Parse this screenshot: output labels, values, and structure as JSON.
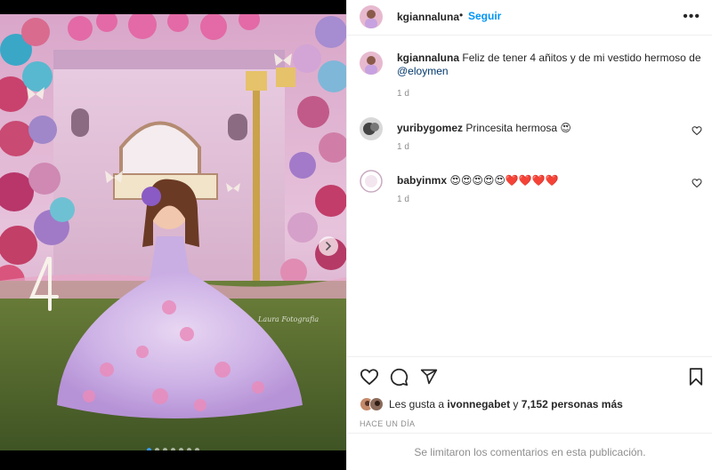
{
  "post": {
    "username": "kgiannaluna",
    "separator": "•",
    "follow_label": "Seguir",
    "more_label": "•••",
    "caption_text": "Feliz de tener 4 añitos y de mi vestido hermoso de ",
    "caption_mention": "@eloymen",
    "caption_time": "1 d",
    "photo_watermark": "Laura Fotografia",
    "carousel_dots": 7,
    "carousel_active": 0
  },
  "comments": [
    {
      "username": "yuribygomez",
      "text": "Princesita hermosa 😍",
      "time": "1 d"
    },
    {
      "username": "babyinmx",
      "text": "😍😍😍😍😍❤️❤️❤️❤️",
      "time": "1 d"
    }
  ],
  "likes": {
    "prefix": "Les gusta a ",
    "user": "ivonnegabet",
    "middle": " y ",
    "count_text": "7,152 personas más"
  },
  "timestamp_label": "HACE UN DÍA",
  "comments_limited": "Se limitaron los comentarios en esta publicación.",
  "colors": {
    "link": "#0095f6",
    "mention": "#00376b",
    "muted": "#8e8e8e",
    "text": "#262626"
  },
  "icons": [
    "more-options-icon",
    "like-icon",
    "comment-icon",
    "share-icon",
    "save-icon",
    "heart-small-icon",
    "next-arrow-icon"
  ]
}
